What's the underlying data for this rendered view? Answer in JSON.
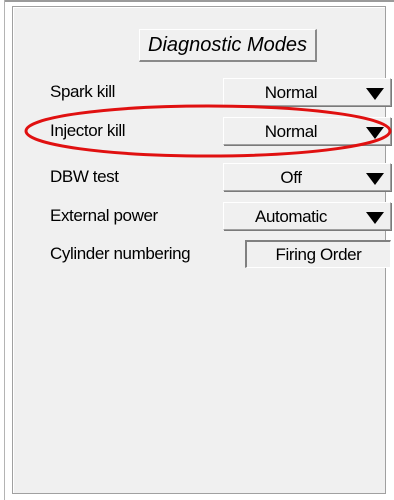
{
  "panel": {
    "title": "Diagnostic Modes"
  },
  "rows": [
    {
      "label": "Spark kill",
      "value": "Normal",
      "control": "dropdown"
    },
    {
      "label": "Injector kill",
      "value": "Normal",
      "control": "dropdown"
    },
    {
      "label": "DBW test",
      "value": "Off",
      "control": "dropdown"
    },
    {
      "label": "External power",
      "value": "Automatic",
      "control": "dropdown"
    },
    {
      "label": "Cylinder numbering",
      "value": "Firing Order",
      "control": "static"
    }
  ],
  "icons": {
    "dropdown_arrow": "triangle-down"
  },
  "colors": {
    "panel_background": "#f0f0f0",
    "annotation": "#e01010"
  }
}
